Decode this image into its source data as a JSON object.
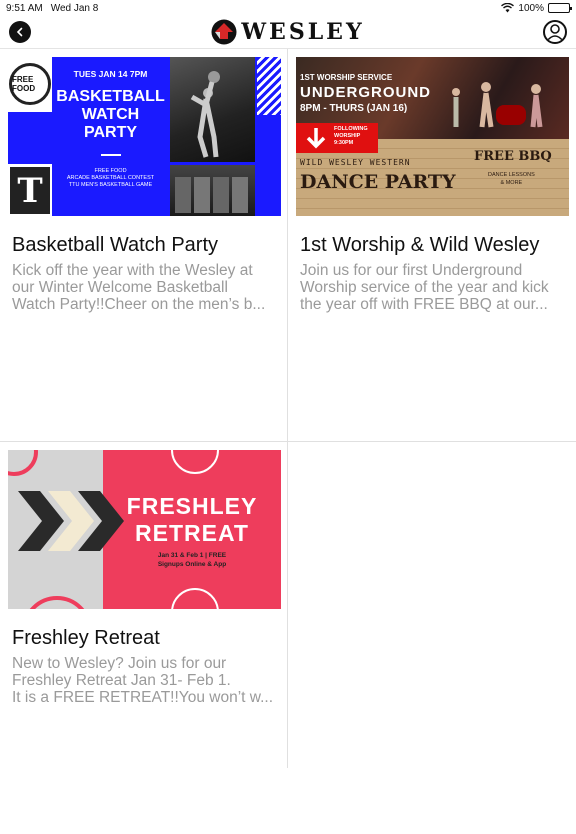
{
  "status_bar": {
    "time": "9:51 AM",
    "date": "Wed Jan 8",
    "battery": "100%"
  },
  "header": {
    "logo_text": "WESLEY"
  },
  "cards": [
    {
      "title": "Basketball Watch Party",
      "desc_lines": [
        "Kick off the year with the Wesley at",
        "our Winter Welcome Basketball",
        "Watch Party!!Cheer on the men’s b..."
      ],
      "banner": {
        "stamp": "FREE FOOD",
        "date": "TUES JAN 14  7PM",
        "headline_lines": [
          "BASKETBALL",
          "WATCH",
          "PARTY"
        ],
        "details": [
          "FREE FOOD",
          "ARCADE BASKETBALL CONTEST",
          "TTU MEN'S BASKETBALL GAME"
        ],
        "logo_letter": "T"
      }
    },
    {
      "title": "1st Worship & Wild Wesley",
      "desc_lines": [
        "Join us for our first Underground",
        "Worship service of the year and kick",
        "the year off with FREE BBQ at our..."
      ],
      "banner": {
        "worship": "1ST WORSHIP SERVICE",
        "underground": "UNDERGROUND",
        "times": "8PM - THURS (JAN 16)",
        "following": [
          "FOLLOWING",
          "WORSHIP",
          "9:30PM"
        ],
        "wild": "WILD WESLEY WESTERN",
        "dance": "DANCE PARTY",
        "bbq": "FREE BBQ",
        "lessons": [
          "DANCE LESSONS",
          "& MORE"
        ]
      }
    },
    {
      "title": "Freshley Retreat",
      "desc_lines": [
        "New to Wesley?  Join us for our",
        "Freshley Retreat Jan 31- Feb 1.",
        "It is a FREE RETREAT!!You won’t w..."
      ],
      "banner": {
        "headline_lines": [
          "FRESHLEY",
          "RETREAT"
        ],
        "dates": "Jan 31 & Feb 1  |  FREE",
        "signups": "Signups Online & App"
      }
    }
  ],
  "colors": {
    "brand_red": "#d62828",
    "blue": "#1a1aff",
    "pink": "#ee3d5c",
    "muted_text": "#9a9a9a"
  }
}
